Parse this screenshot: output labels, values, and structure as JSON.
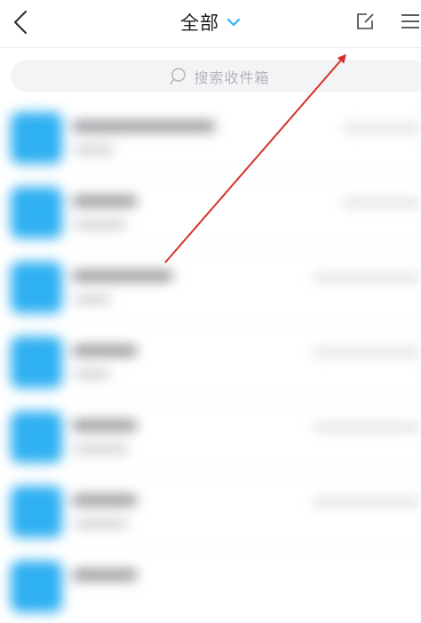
{
  "header": {
    "title": "全部",
    "back_icon": "chevron-left-icon",
    "dropdown_icon": "chevron-down-icon",
    "compose_icon": "compose-icon",
    "menu_icon": "menu-icon"
  },
  "search": {
    "placeholder": "搜索收件箱",
    "icon": "search-icon"
  },
  "colors": {
    "accent": "#2fb0f2",
    "annotation": "#d6302a"
  }
}
